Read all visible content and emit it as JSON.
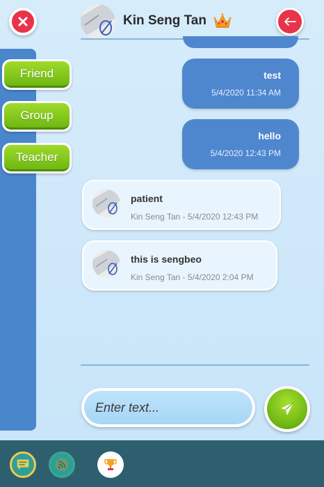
{
  "header": {
    "contact_name": "Kin Seng Tan",
    "close_icon": "close-icon",
    "back_icon": "arrow-left-icon",
    "badge_icon": "crown-icon"
  },
  "sidebar": {
    "items": [
      {
        "label": "Friend"
      },
      {
        "label": "Group"
      },
      {
        "label": "Teacher"
      }
    ]
  },
  "messages": {
    "outgoing": [
      {
        "text": "test",
        "time": "5/4/2020 11:34 AM"
      },
      {
        "text": "hello",
        "time": "5/4/2020 12:43 PM"
      }
    ],
    "incoming": [
      {
        "text": "patient",
        "meta": "Kin Seng Tan - 5/4/2020 12:43 PM"
      },
      {
        "text": "this is sengbeo",
        "meta": "Kin Seng Tan - 5/4/2020 2:04 PM"
      }
    ]
  },
  "composer": {
    "placeholder": "Enter text...",
    "value": "",
    "send_icon": "send-icon"
  },
  "bottom_bar": {
    "icons": [
      "chat-icon",
      "feed-icon",
      "trophy-icon"
    ]
  },
  "colors": {
    "accent_red": "#e8334a",
    "sidebar_blue": "#4a86cc",
    "bubble_blue": "#4f87cf",
    "green": "#7cc41c",
    "bottom_bar": "#2e5f6f"
  }
}
